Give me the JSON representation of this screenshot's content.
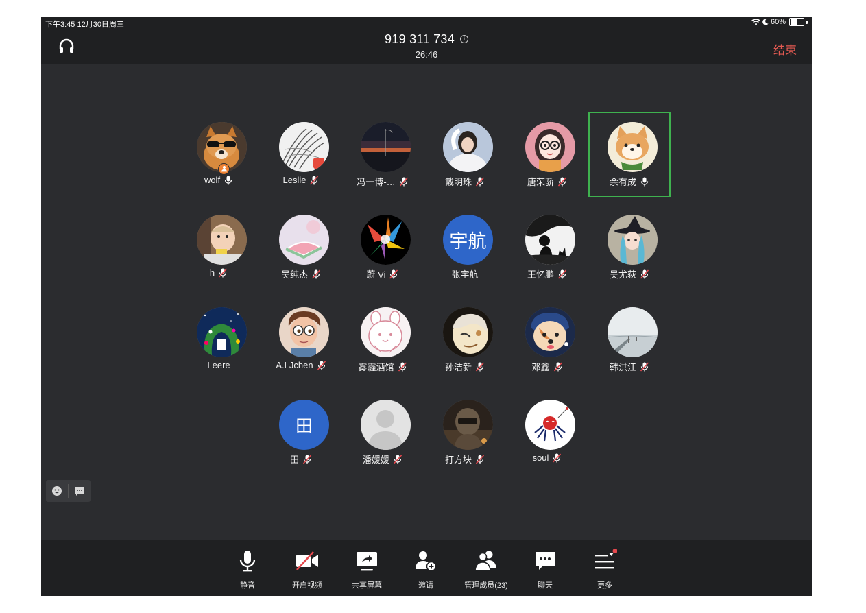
{
  "status_bar": {
    "time_date": "下午3:45   12月30日周三",
    "battery": "60%",
    "battery_level": 0.6
  },
  "header": {
    "meeting_id": "919 311 734",
    "info_glyph": "i",
    "duration": "26:46",
    "end_label": "结束"
  },
  "participants": [
    {
      "name": "wolf",
      "mic": "on",
      "host": true,
      "avatar": "dog-sunglasses"
    },
    {
      "name": "Leslie",
      "mic": "muted",
      "avatar": "sketch"
    },
    {
      "name": "冯一博-…",
      "mic": "muted",
      "avatar": "sunset"
    },
    {
      "name": "戴明珠",
      "mic": "muted",
      "avatar": "portrait-white"
    },
    {
      "name": "唐荣骄",
      "mic": "muted",
      "avatar": "cartoon-girl"
    },
    {
      "name": "余有成",
      "mic": "on",
      "active": true,
      "avatar": "shiba"
    },
    {
      "name": "h",
      "mic": "muted",
      "avatar": "child"
    },
    {
      "name": "吴纯杰",
      "mic": "muted",
      "avatar": "watermelon"
    },
    {
      "name": "蔚 Vi",
      "mic": "muted",
      "avatar": "color-burst"
    },
    {
      "name": "张宇航",
      "mic": "none",
      "avatar_text": "宇航",
      "avatar_color": "#2e66c9"
    },
    {
      "name": "王忆鹏",
      "mic": "muted",
      "avatar": "silhouette"
    },
    {
      "name": "吴尤荻",
      "mic": "muted",
      "avatar": "witch"
    },
    {
      "name": "Leere",
      "mic": "none",
      "avatar": "garden"
    },
    {
      "name": "A.LJchen",
      "mic": "muted",
      "avatar": "cartoon-boy"
    },
    {
      "name": "雾霾酒馆",
      "mic": "muted",
      "avatar": "bunny"
    },
    {
      "name": "孙洁新",
      "mic": "muted",
      "avatar": "anime"
    },
    {
      "name": "邓鑫",
      "mic": "muted",
      "avatar": "pearl-dog"
    },
    {
      "name": "韩洪江",
      "mic": "muted",
      "avatar": "seaside"
    },
    {
      "name": "田",
      "mic": "muted",
      "avatar_text": "田",
      "avatar_color": "#2e66c9"
    },
    {
      "name": "潘媛媛",
      "mic": "muted",
      "avatar": "default-person"
    },
    {
      "name": "打方块",
      "mic": "muted",
      "avatar": "helmet"
    },
    {
      "name": "soul",
      "mic": "muted",
      "avatar": "spider"
    }
  ],
  "toolbar": {
    "mute_label": "静音",
    "video_label": "开启视频",
    "share_label": "共享屏幕",
    "invite_label": "邀请",
    "members_label": "管理成员(23)",
    "chat_label": "聊天",
    "more_label": "更多"
  },
  "icons": {
    "headphone": "headphone-icon",
    "emoji": "emoji-icon",
    "chat_bubble": "chat-bubble-icon",
    "mic": "microphone-icon",
    "video_off": "video-off-icon",
    "share": "share-screen-icon",
    "invite": "invite-user-icon",
    "members": "members-icon",
    "chat": "chat-icon",
    "more": "more-menu-icon"
  },
  "colors": {
    "end": "#e55a52",
    "active_border": "#3fb24f",
    "host_badge": "#f08232",
    "notification_dot": "#e5484d"
  }
}
